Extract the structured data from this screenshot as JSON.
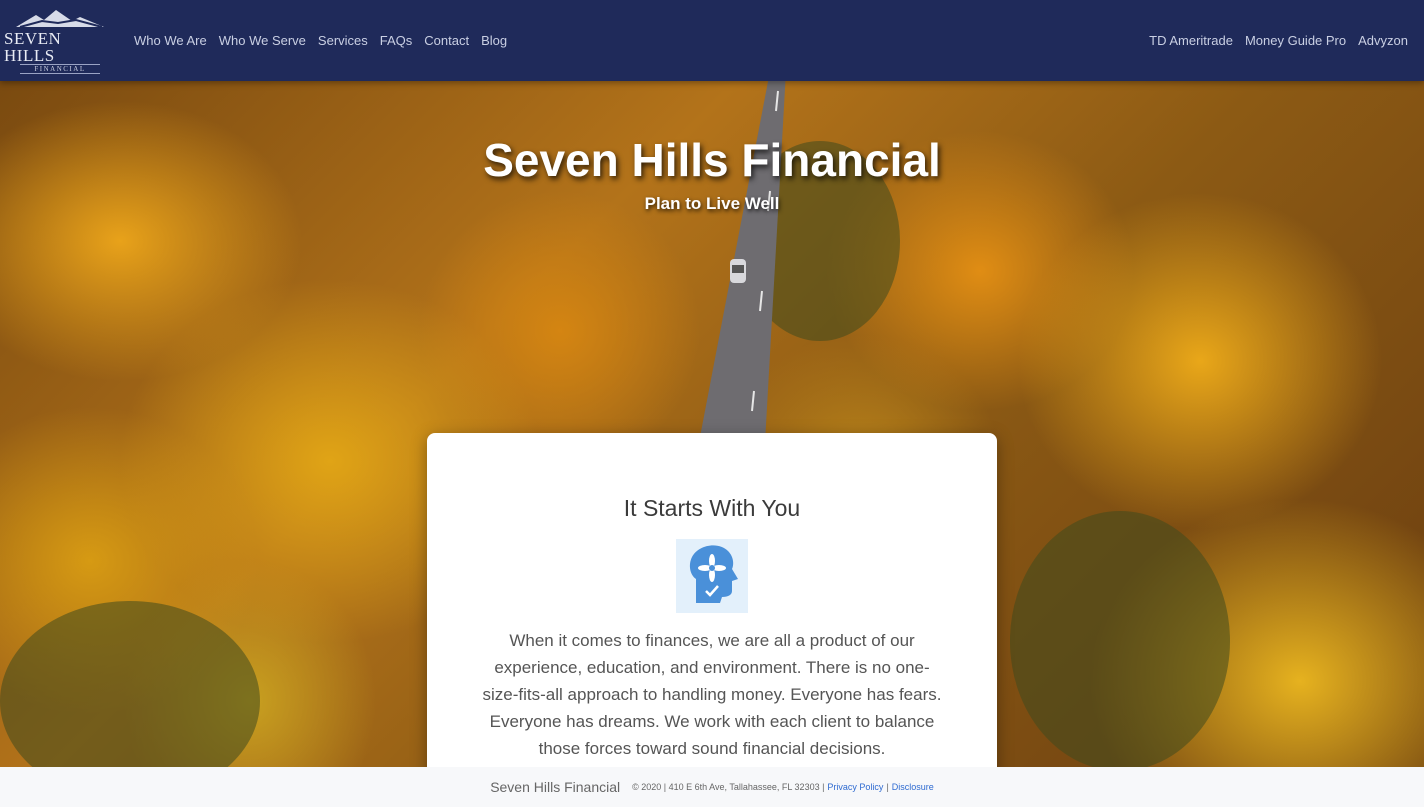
{
  "logo": {
    "main": "SEVEN HILLS",
    "sub": "FINANCIAL"
  },
  "nav": {
    "left": [
      "Who We Are",
      "Who We Serve",
      "Services",
      "FAQs",
      "Contact",
      "Blog"
    ],
    "right": [
      "TD Ameritrade",
      "Money Guide Pro",
      "Advyzon"
    ]
  },
  "hero": {
    "title": "Seven Hills Financial",
    "subtitle": "Plan to Live Well"
  },
  "card": {
    "title": "It Starts With You",
    "icon": "head-flower-check-icon",
    "text": "When it comes to finances, we are all a product of our experience, education, and environment. There is no one-size-fits-all approach to handling money. Everyone has fears. Everyone has dreams. We work with each client to balance those forces toward sound financial decisions."
  },
  "footer": {
    "brand": "Seven Hills Financial",
    "info": "© 2020 | 410 E 6th Ave, Tallahassee, FL 32303 |",
    "privacy": "Privacy Policy",
    "separator": "|",
    "disclosure": "Disclosure"
  },
  "colors": {
    "navbar": "#1f2a5a",
    "link": "#2f6bd1",
    "icon": "#4a90d9"
  }
}
